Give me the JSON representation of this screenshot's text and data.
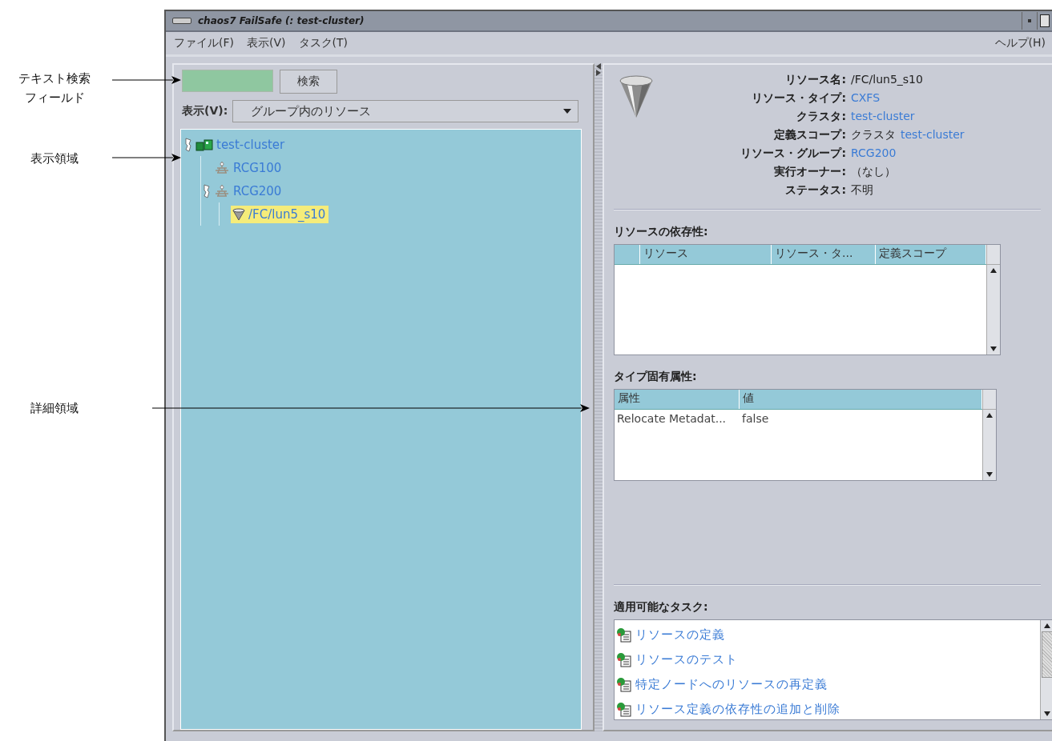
{
  "annotations": [
    {
      "lines": [
        "テキスト検索",
        "フィールド"
      ]
    },
    {
      "lines": [
        "表示領域"
      ]
    },
    {
      "lines": [
        "詳細領域"
      ]
    }
  ],
  "window": {
    "title": "chaos7 FailSafe (: test-cluster)"
  },
  "menu": {
    "items": [
      "ファイル(F)",
      "表示(V)",
      "タスク(T)"
    ],
    "help": "ヘルプ(H)"
  },
  "search": {
    "button": "検索"
  },
  "view": {
    "label": "表示(V):",
    "value": "グループ内のリソース"
  },
  "tree": [
    {
      "label": "test-cluster",
      "kind": "cluster",
      "expanded": true,
      "selected": false,
      "children": [
        {
          "label": "RCG100",
          "kind": "group",
          "selected": false
        },
        {
          "label": "RCG200",
          "kind": "group",
          "expanded": true,
          "selected": false,
          "children": [
            {
              "label": "/FC/lun5_s10",
              "kind": "resource",
              "selected": true
            }
          ]
        }
      ]
    }
  ],
  "details": {
    "properties": [
      {
        "label": "リソース名:",
        "value": [
          {
            "text": "/FC/lun5_s10",
            "link": false
          }
        ]
      },
      {
        "label": "リソース・タイプ:",
        "value": [
          {
            "text": "CXFS",
            "link": true
          }
        ]
      },
      {
        "label": "クラスタ:",
        "value": [
          {
            "text": "test-cluster",
            "link": true
          }
        ]
      },
      {
        "label": "定義スコープ:",
        "value": [
          {
            "text": "クラスタ",
            "link": false
          },
          {
            "text": "test-cluster",
            "link": true
          }
        ]
      },
      {
        "label": "リソース・グループ:",
        "value": [
          {
            "text": "RCG200",
            "link": true
          }
        ]
      },
      {
        "label": "実行オーナー:",
        "value": [
          {
            "text": "（なし）",
            "link": false
          }
        ]
      },
      {
        "label": "ステータス:",
        "value": [
          {
            "text": "不明",
            "link": false
          }
        ]
      }
    ],
    "dependencies": {
      "title": "リソースの依存性:",
      "columns": [
        "リソース",
        "リソース・タ...",
        "定義スコープ"
      ]
    },
    "attributes": {
      "title": "タイプ固有属性:",
      "columns": [
        "属性",
        "値"
      ],
      "rows": [
        [
          "Relocate Metadat...",
          "false"
        ]
      ]
    },
    "tasks": {
      "title": "適用可能なタスク:",
      "items": [
        "リソースの定義",
        "リソースのテスト",
        "特定ノードへのリソースの再定義",
        "リソース定義の依存性の追加と削除"
      ]
    }
  }
}
